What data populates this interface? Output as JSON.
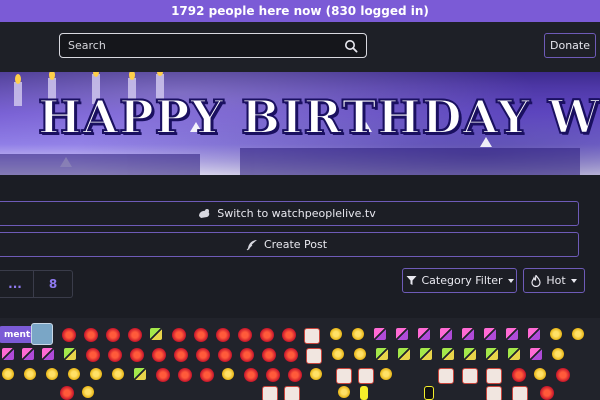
{
  "topbar": {
    "online_text": "1792 people here now (830 logged in)"
  },
  "navbar": {
    "search_placeholder": "Search",
    "donate_label": "Donate"
  },
  "banner": {
    "title": "HAPPY BIRTHDAY WPD"
  },
  "actions": {
    "switch_label": "Switch to watchpeoplelive.tv",
    "create_label": "Create Post"
  },
  "pagination": {
    "ellipsis": "...",
    "page": "8"
  },
  "sort": {
    "category_filter_label": "Category Filter",
    "hot_label": "Hot"
  },
  "emotes": {
    "tag_label": "ments"
  },
  "colors": {
    "accent": "#7b5bd6",
    "border_accent": "#6e5bb8",
    "background": "#1b1d24"
  }
}
